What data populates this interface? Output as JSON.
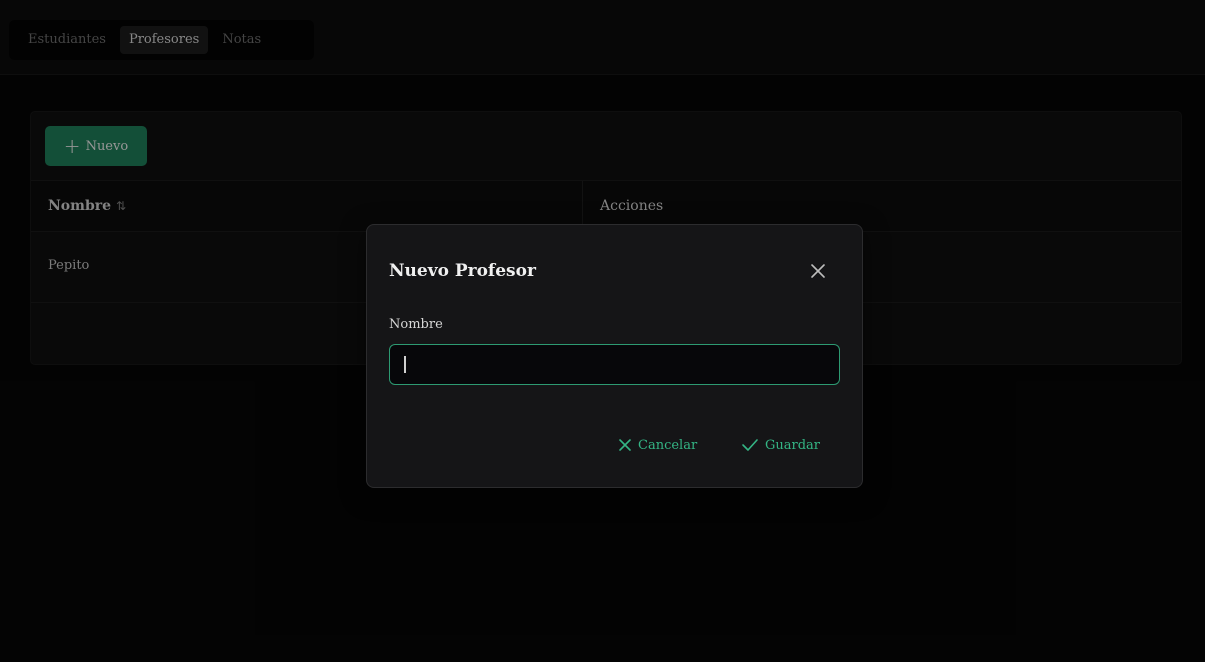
{
  "nav": {
    "tabs": [
      {
        "label": "Estudiantes",
        "active": false
      },
      {
        "label": "Profesores",
        "active": true
      },
      {
        "label": "Notas",
        "active": false
      }
    ]
  },
  "toolbar": {
    "new_label": "Nuevo",
    "new_icon": "plus-icon"
  },
  "table": {
    "columns": [
      "Nombre",
      "Acciones"
    ],
    "sort_icon": "sort-icon",
    "rows": [
      {
        "nombre": "Pepito"
      }
    ]
  },
  "dialog": {
    "title": "Nuevo Profesor",
    "close_icon": "close-icon",
    "field_label": "Nombre",
    "field_value": "",
    "cancel_label": "Cancelar",
    "cancel_icon": "close-icon",
    "save_label": "Guardar",
    "save_icon": "check-icon"
  },
  "colors": {
    "accent": "#34b585",
    "button_bg": "#1e7a56",
    "background": "#060606"
  }
}
